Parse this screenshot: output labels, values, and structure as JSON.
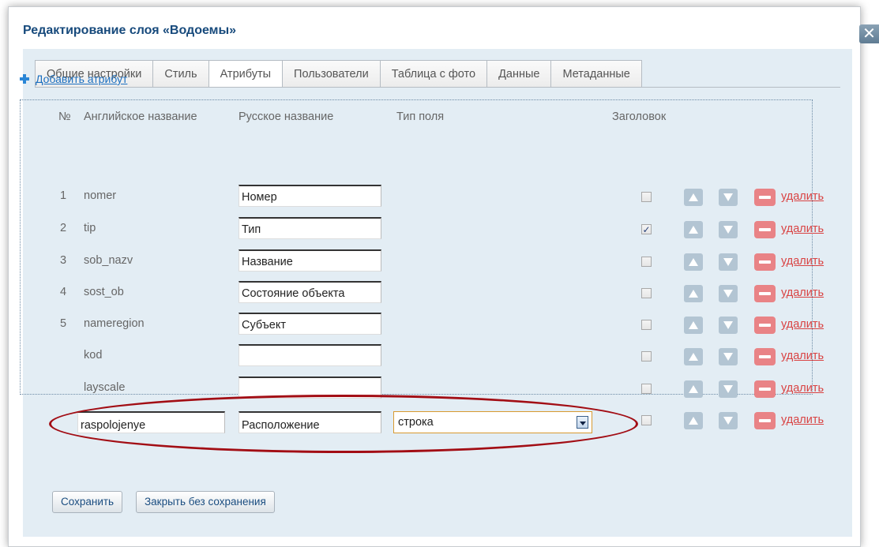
{
  "dialog": {
    "title": "Редактирование слоя «Водоемы»",
    "close_label": "✕"
  },
  "tabs": [
    {
      "label": "Общие настройки",
      "active": false
    },
    {
      "label": "Стиль",
      "active": false
    },
    {
      "label": "Атрибуты",
      "active": true
    },
    {
      "label": "Пользователи",
      "active": false
    },
    {
      "label": "Таблица с фото",
      "active": false
    },
    {
      "label": "Данные",
      "active": false
    },
    {
      "label": "Метаданные",
      "active": false
    }
  ],
  "add_attribute_label": "Добавить атрибут",
  "table": {
    "headers": {
      "num": "№",
      "english": "Английское название",
      "russian": "Русское название",
      "type": "Тип поля",
      "title": "Заголовок"
    },
    "rows": [
      {
        "num": "1",
        "english": "nomer",
        "russian": "Номер",
        "is_title": false
      },
      {
        "num": "2",
        "english": "tip",
        "russian": "Тип",
        "is_title": true
      },
      {
        "num": "3",
        "english": "sob_nazv",
        "russian": "Название",
        "is_title": false
      },
      {
        "num": "4",
        "english": "sost_ob",
        "russian": "Состояние объекта",
        "is_title": false
      },
      {
        "num": "5",
        "english": "nameregion",
        "russian": "Субъект",
        "is_title": false
      },
      {
        "num": "",
        "english": "kod",
        "russian": "",
        "is_title": false
      },
      {
        "num": "",
        "english": "layscale",
        "russian": "",
        "is_title": false
      }
    ],
    "new_row": {
      "english": "raspolojenye",
      "russian": "Расположение",
      "type": "строка",
      "is_title": false
    },
    "delete_label": "удалить"
  },
  "buttons": {
    "save": "Сохранить",
    "close_without_save": "Закрыть без сохранения"
  },
  "colors": {
    "accent": "#174a7c",
    "link": "#1b6fc0",
    "delete": "#d94343",
    "highlight": "#a20d14"
  }
}
